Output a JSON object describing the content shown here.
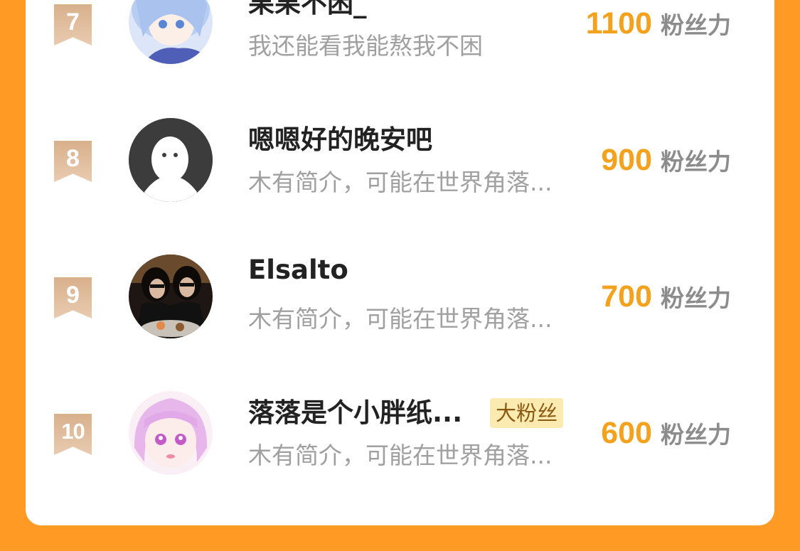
{
  "ranking": [
    {
      "rank": "7",
      "name": "果果不困_",
      "bio": "我还能看我能熬我不困",
      "score": "1100",
      "score_unit": "粉丝力",
      "badge": null
    },
    {
      "rank": "8",
      "name": "嗯嗯好的晚安吧",
      "bio": "木有简介，可能在世界角落...",
      "score": "900",
      "score_unit": "粉丝力",
      "badge": null
    },
    {
      "rank": "9",
      "name": "Elsalto",
      "bio": "木有简介，可能在世界角落...",
      "score": "700",
      "score_unit": "粉丝力",
      "badge": null
    },
    {
      "rank": "10",
      "name": "落落是个小胖纸...",
      "bio": "木有简介，可能在世界角落...",
      "score": "600",
      "score_unit": "粉丝力",
      "badge": "大粉丝"
    }
  ],
  "colors": {
    "background": "#FF9A24",
    "score": "#F4A21D",
    "badge_bg": "#FCEBB0"
  }
}
